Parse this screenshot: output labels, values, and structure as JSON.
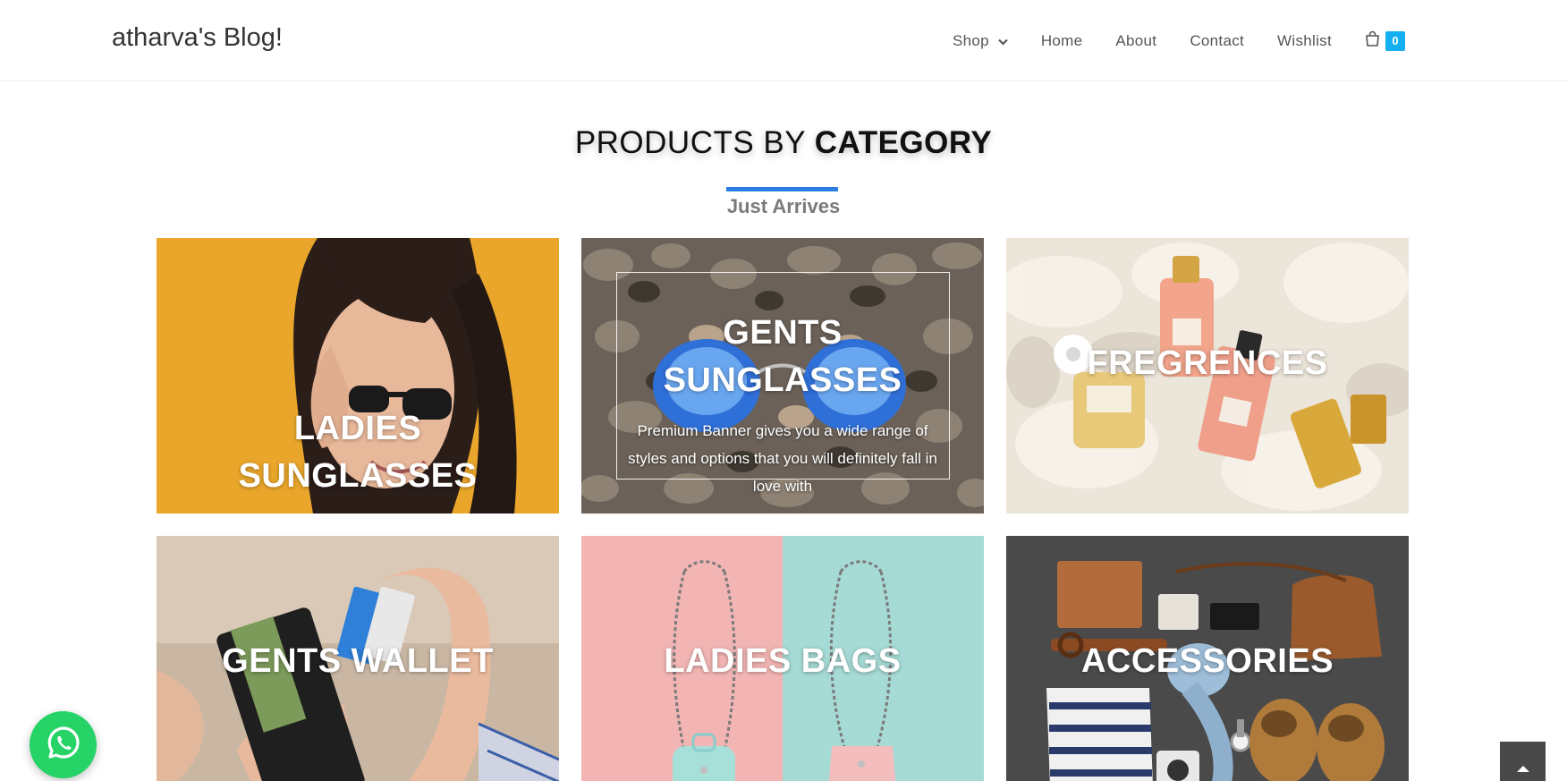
{
  "site": {
    "title": "atharva's Blog!"
  },
  "nav": {
    "items": [
      {
        "label": "Shop",
        "has_dropdown": true
      },
      {
        "label": "Home"
      },
      {
        "label": "About"
      },
      {
        "label": "Contact"
      },
      {
        "label": "Wishlist"
      }
    ],
    "cart": {
      "icon": "shopping-bag-icon",
      "count": "0"
    }
  },
  "section": {
    "title_plain": "PRODUCTS BY",
    "title_bold": "CATEGORY",
    "subtitle": "Just Arrives"
  },
  "categories": [
    {
      "title_line1": "LADIES",
      "title_line2": "SUNGLASSES"
    },
    {
      "title_line1": "GENTS",
      "title_line2": "SUNGLASSES",
      "description": "Premium Banner gives you a wide range of styles and options that you will definitely fall in love with"
    },
    {
      "title": "FREGRENCES"
    },
    {
      "title": "GENTS WALLET"
    },
    {
      "title": "LADIES BAGS"
    },
    {
      "title": "ACCESSORIES"
    }
  ],
  "colors": {
    "accent": "#13aff0",
    "title_bar": "#2a7ee0",
    "whatsapp": "#25d366"
  },
  "floating": {
    "whatsapp_icon": "whatsapp-icon",
    "scroll_top_icon": "chevron-up-icon"
  }
}
